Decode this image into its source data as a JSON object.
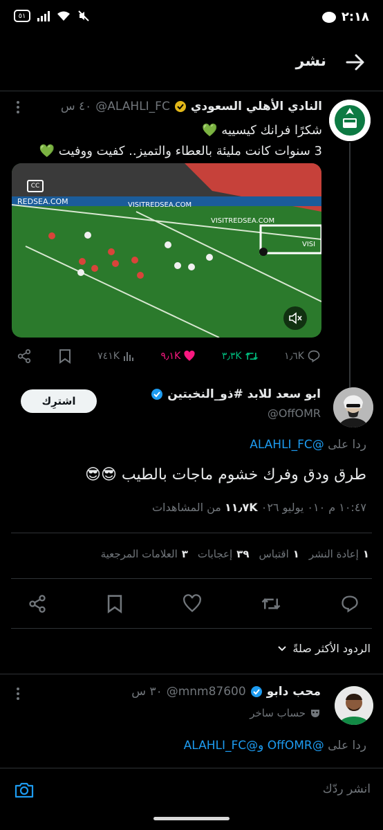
{
  "status_bar": {
    "time": "٢:١٨",
    "battery": "٥١"
  },
  "header": {
    "title": "نشر"
  },
  "parent_tweet": {
    "name": "النادي الأهلي السعودي",
    "handle": "@ALAHLI_FC",
    "age": "٤٠ س",
    "line1": "شكرًا فرانك كيسييه 💚",
    "line2": "3 سنوات كانت مليئة بالعطاء والتميز.. كفيت ووفيت 💚",
    "video": {
      "ads": [
        "REDSEA.COM",
        "VISITREDSEA.COM",
        "VISITREDSEA.COM",
        "VISI"
      ]
    },
    "stats": {
      "replies": "١٫٦K",
      "reposts": "٣٫٣K",
      "likes": "٩٫١K",
      "views": "٧٤١K"
    }
  },
  "main_tweet": {
    "name": "ابو سعد للابد #ذو_النخبتين",
    "handle": "@OffOMR",
    "subscribe_label": "اشترِك",
    "reply_to_prefix": "ردا على",
    "reply_to_handle": "@ALAHLI_FC",
    "text": "طرق ودق وفرك خشوم ماجات بالطيب 😎😎",
    "time_date": "١٠:٤٧ م ٠١٠ يوليو ٠٢٦",
    "views_count": "١١٫٧K",
    "views_label": "من المشاهدات",
    "stats": [
      {
        "value": "١",
        "label": "إعادة النشر"
      },
      {
        "value": "١",
        "label": "اقتباس"
      },
      {
        "value": "٣٩",
        "label": "إعجابات"
      },
      {
        "value": "٣",
        "label": "العلامات المرجعية"
      }
    ]
  },
  "sort": {
    "label": "الردود الأكثر صلةً"
  },
  "reply_tweet": {
    "name": "محب دابو",
    "handle": "@mnm87600",
    "age": "٣٠ س",
    "parody_label": "حساب ساخر",
    "reply_to_prefix": "ردا على",
    "reply_to_handles": "@OffOMR و@ALAHLI_FC"
  },
  "compose": {
    "placeholder": "انشر ردّك"
  },
  "colors": {
    "accent": "#1d9bf0",
    "like": "#f91880",
    "repost": "#00ba7c",
    "background": "#000000"
  }
}
